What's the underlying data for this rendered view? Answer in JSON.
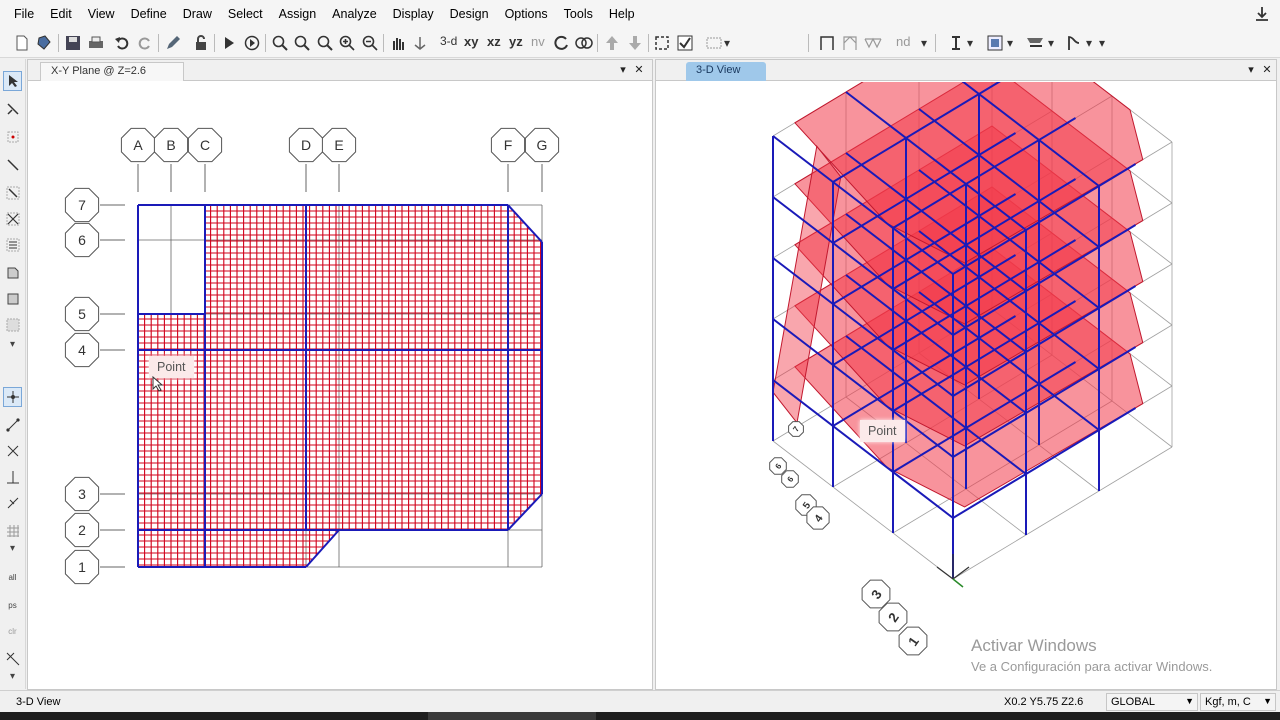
{
  "menu": [
    "File",
    "Edit",
    "View",
    "Define",
    "Draw",
    "Select",
    "Assign",
    "Analyze",
    "Display",
    "Design",
    "Options",
    "Tools",
    "Help"
  ],
  "toolbar": {
    "view_3d": "3-d",
    "view_xy": "xy",
    "view_xz": "xz",
    "view_yz": "yz",
    "view_nv": "nv",
    "nd": "nd",
    "icons": [
      "new-model-icon",
      "open-icon",
      "save-icon",
      "print-icon",
      "undo-icon",
      "redo-icon",
      "pencil-icon",
      "lock-icon",
      "run-icon",
      "run-step-icon",
      "zoom-window-icon",
      "zoom-restore-icon",
      "zoom-in-icon",
      "zoom-out-icon",
      "pan-icon",
      "rotate-icon",
      "snap-icon"
    ]
  },
  "left_pane": {
    "title": "X-Y Plane @ Z=2.6",
    "grid_x_labels": [
      "A",
      "B",
      "C",
      "D",
      "E",
      "F",
      "G"
    ],
    "grid_y_labels": [
      "7",
      "6",
      "5",
      "4",
      "3",
      "2",
      "1"
    ],
    "tooltip": "Point"
  },
  "right_pane": {
    "title": "3-D View",
    "tooltip": "Point",
    "grid_bubbles": [
      "7",
      "6",
      "5",
      "4",
      "3",
      "2",
      "1"
    ]
  },
  "status": {
    "left": "3-D View",
    "coords": "X0.2  Y5.75  Z2.6",
    "coord_system": "GLOBAL",
    "units": "Kgf, m, C"
  },
  "watermark": {
    "line1": "Activar Windows",
    "line2": "Ve a Configuración para activar Windows."
  },
  "colors": {
    "frame": "#1a1ab8",
    "mesh": "#d0001a",
    "slab_fill": "#f23a4a",
    "active_tab": "#9fc8ea"
  }
}
